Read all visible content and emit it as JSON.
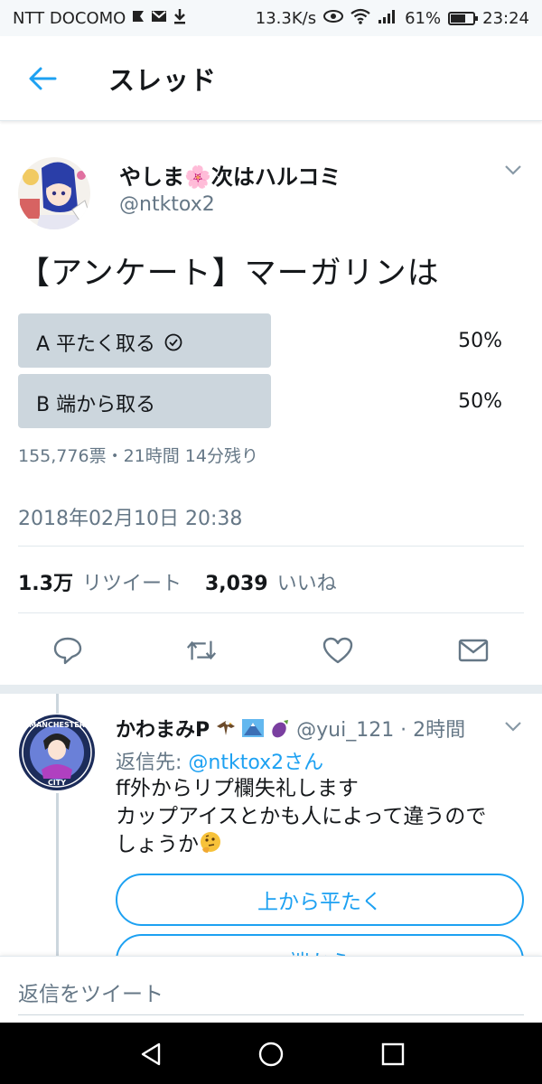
{
  "status_bar": {
    "carrier": "NTT DOCOMO",
    "net_speed": "13.3K/s",
    "battery": "61%",
    "time": "23:24"
  },
  "header": {
    "title": "スレッド"
  },
  "tweet": {
    "author_name": "やしま🌸次はハルコミ",
    "author_handle": "@ntktox2",
    "text": "【アンケート】マーガリンは",
    "poll": {
      "options": [
        {
          "label": "A 平たく取る",
          "percent_label": "50%",
          "percent": 50,
          "selected": true
        },
        {
          "label": "B 端から取る",
          "percent_label": "50%",
          "percent": 50,
          "selected": false
        }
      ],
      "meta": "155,776票・21時間 14分残り"
    },
    "timestamp": "2018年02月10日 20:38",
    "retweet_count": "1.3万",
    "retweet_label": "リツイート",
    "like_count": "3,039",
    "like_label": "いいね"
  },
  "reply": {
    "name": "かわまみP",
    "handle_time": "@yui_121 · 2時間",
    "reply_to_prefix": "返信先: ",
    "reply_to_mention": "@ntktox2さん",
    "text_line1": "ff外からリプ欄失礼します",
    "text_line2": "カップアイスとかも人によって違うので",
    "text_line3": "しょうか",
    "avatar_text_top": "MANCHESTER",
    "avatar_text_bottom": "CITY",
    "poll_options": [
      "上から平たく",
      "端から"
    ]
  },
  "compose": {
    "placeholder": "返信をツイート"
  },
  "colors": {
    "accent": "#1da1f2",
    "muted": "#657786",
    "poll_bar": "#ccd6dd"
  }
}
